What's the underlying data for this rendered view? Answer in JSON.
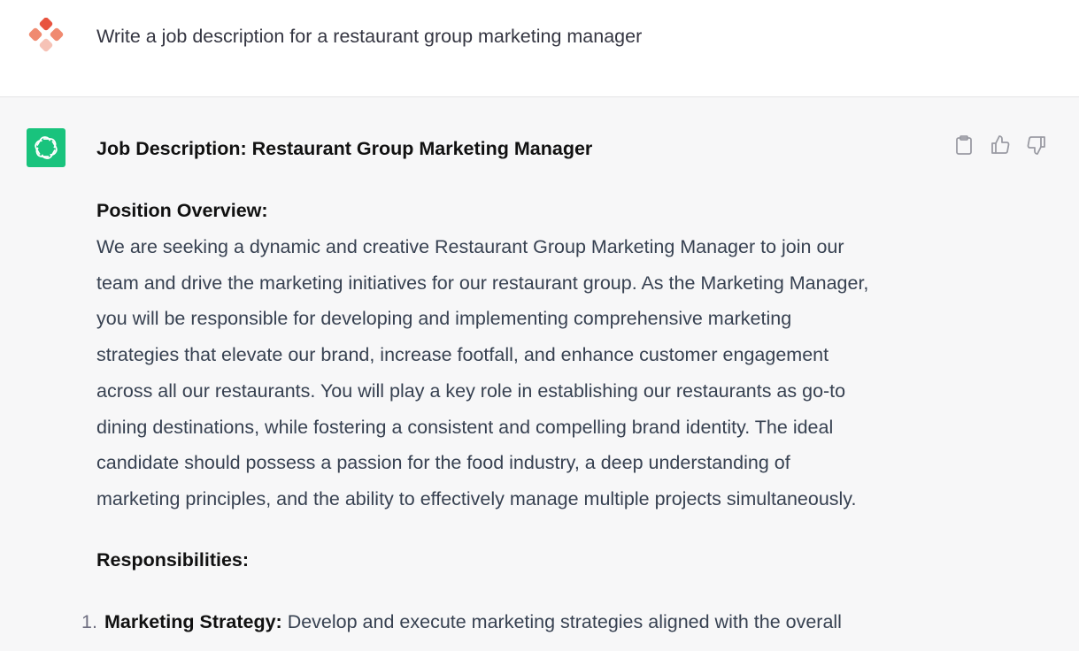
{
  "user_message": {
    "text": "Write a job description for a restaurant group marketing manager",
    "avatar_icon": "user-avatar-diamonds-icon",
    "avatar_colors": [
      "#e8533f",
      "#f08a70",
      "#f6b8a8"
    ]
  },
  "assistant_message": {
    "avatar_icon": "openai-logo-icon",
    "avatar_color": "#19c37d",
    "actions": [
      {
        "name": "copy-button",
        "icon": "clipboard-icon"
      },
      {
        "name": "thumbs-up-button",
        "icon": "thumbs-up-icon"
      },
      {
        "name": "thumbs-down-button",
        "icon": "thumbs-down-icon"
      }
    ],
    "title": "Job Description: Restaurant Group Marketing Manager",
    "overview_heading": "Position Overview:",
    "overview_lines": [
      "We are seeking a dynamic and creative Restaurant Group Marketing Manager to join our",
      "team and drive the marketing initiatives for our restaurant group. As the Marketing Manager,",
      "you will be responsible for developing and implementing comprehensive marketing",
      "strategies that elevate our brand, increase footfall, and enhance customer engagement",
      "across all our restaurants. You will play a key role in establishing our restaurants as go-to",
      "dining destinations, while fostering a consistent and compelling brand identity. The ideal",
      "candidate should possess a passion for the food industry, a deep understanding of",
      "marketing principles, and the ability to effectively manage multiple projects simultaneously."
    ],
    "responsibilities_heading": "Responsibilities:",
    "responsibilities": [
      {
        "number": "1.",
        "title": "Marketing Strategy:",
        "text": "Develop and execute marketing strategies aligned with the overall"
      }
    ]
  }
}
